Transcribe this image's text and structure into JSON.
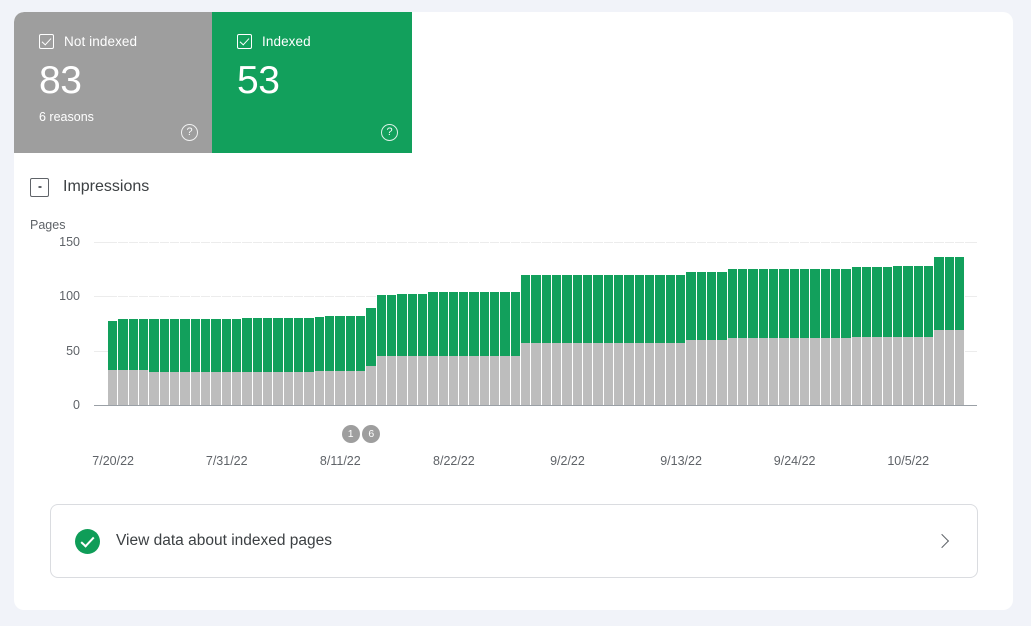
{
  "theme": {
    "page_background": "#f1f3f9",
    "card_background": "#ffffff",
    "indexed_color": "#12a05c",
    "not_indexed_color": "#9e9e9e",
    "bar_not_indexed_color": "#bdbdbd",
    "text_color": "#3c4043",
    "muted_text_color": "#5f6368"
  },
  "summary": {
    "cards": [
      {
        "key": "not_indexed",
        "label": "Not indexed",
        "value": "83",
        "sub": "6 reasons",
        "checkbox_state": "checked",
        "help_icon": "help-icon",
        "help_glyph": "?"
      },
      {
        "key": "indexed",
        "label": "Indexed",
        "value": "53",
        "sub": "",
        "checkbox_state": "checked",
        "help_icon": "help-icon",
        "help_glyph": "?"
      }
    ]
  },
  "impressions": {
    "label": "Impressions",
    "checkbox_state": "unchecked",
    "checkbox_icon": "checkbox-indeterminate-icon"
  },
  "footer_action": {
    "label": "View data about indexed pages",
    "leading_icon": "check-circle-icon",
    "trailing_icon": "chevron-right-icon"
  },
  "chart_data": {
    "type": "bar",
    "stacked": true,
    "title": "",
    "xlabel": "",
    "ylabel": "Pages",
    "ylim": [
      0,
      150
    ],
    "yticks": [
      0,
      50,
      100,
      150
    ],
    "ytick_labels": [
      "0",
      "50",
      "100",
      "150"
    ],
    "grid": true,
    "legend_position": "top-cards",
    "xtick_labels": [
      "7/20/22",
      "7/31/22",
      "8/11/22",
      "8/22/22",
      "9/2/22",
      "9/13/22",
      "9/24/22",
      "10/5/22"
    ],
    "xtick_indices": [
      0,
      11,
      22,
      33,
      44,
      55,
      66,
      77
    ],
    "annotations": [
      {
        "label": "1",
        "index": 23
      },
      {
        "label": "6",
        "index": 25
      }
    ],
    "series": [
      {
        "name": "Not indexed",
        "color": "#bdbdbd",
        "values": [
          32,
          32,
          32,
          32,
          30,
          30,
          30,
          30,
          30,
          30,
          30,
          30,
          30,
          30,
          30,
          30,
          30,
          30,
          30,
          30,
          31,
          31,
          31,
          31,
          31,
          36,
          45,
          45,
          45,
          45,
          45,
          45,
          45,
          45,
          45,
          45,
          45,
          45,
          45,
          45,
          57,
          57,
          57,
          57,
          57,
          57,
          57,
          57,
          57,
          57,
          57,
          57,
          57,
          57,
          57,
          57,
          60,
          60,
          60,
          60,
          62,
          62,
          62,
          62,
          62,
          62,
          62,
          62,
          62,
          62,
          62,
          62,
          63,
          63,
          63,
          63,
          63,
          63,
          63,
          63,
          69,
          69,
          69
        ]
      },
      {
        "name": "Indexed",
        "color": "#12a05c",
        "values": [
          45,
          47,
          47,
          47,
          49,
          49,
          49,
          49,
          49,
          49,
          49,
          49,
          49,
          50,
          50,
          50,
          50,
          50,
          50,
          50,
          50,
          51,
          51,
          51,
          51,
          53,
          56,
          56,
          57,
          57,
          57,
          59,
          59,
          59,
          59,
          59,
          59,
          59,
          59,
          59,
          63,
          63,
          63,
          63,
          63,
          63,
          63,
          63,
          63,
          63,
          63,
          63,
          63,
          63,
          63,
          63,
          62,
          62,
          62,
          62,
          63,
          63,
          63,
          63,
          63,
          63,
          63,
          63,
          63,
          63,
          63,
          63,
          64,
          64,
          64,
          64,
          65,
          65,
          65,
          65,
          67,
          67,
          67
        ]
      }
    ]
  }
}
